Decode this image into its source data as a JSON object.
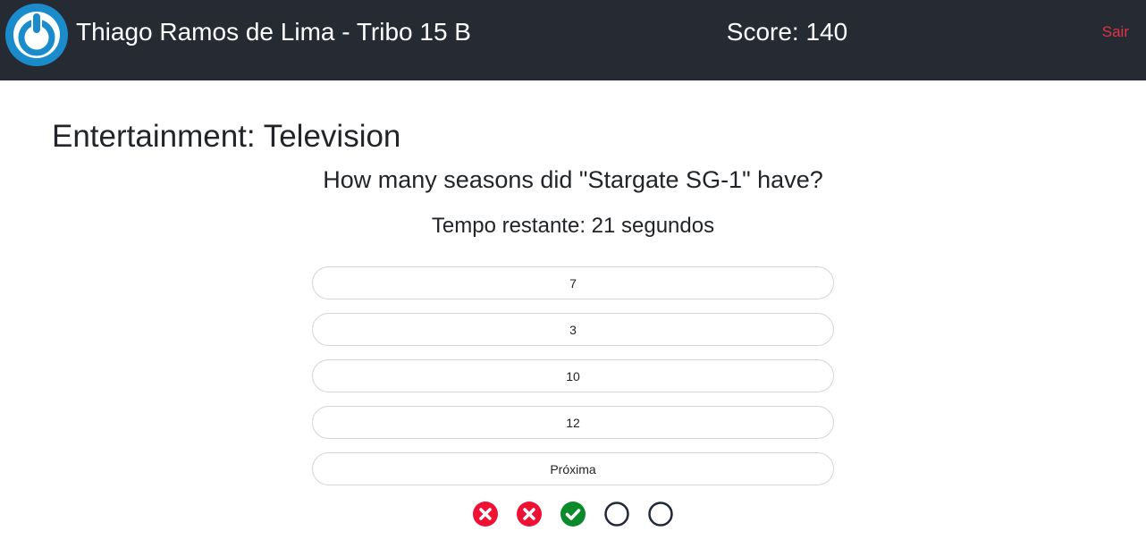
{
  "header": {
    "user": "Thiago Ramos de Lima - Tribo 15 B",
    "score": "Score: 140",
    "logout": "Sair",
    "logo_icon": "power-button-icon"
  },
  "quiz": {
    "category": "Entertainment: Television",
    "question": "How many seasons did \"Stargate SG-1\" have?",
    "timer": "Tempo restante: 21 segundos",
    "options": [
      "7",
      "3",
      "10",
      "12"
    ],
    "next": "Próxima",
    "results": [
      "wrong",
      "wrong",
      "correct",
      "pending",
      "pending"
    ]
  },
  "colors": {
    "navbar": "#262a33",
    "logo_blue": "#1a8ccc",
    "logout": "#dc3545",
    "wrong": "#ee1133",
    "correct": "#0a8a2a",
    "pending": "#1f2937"
  }
}
